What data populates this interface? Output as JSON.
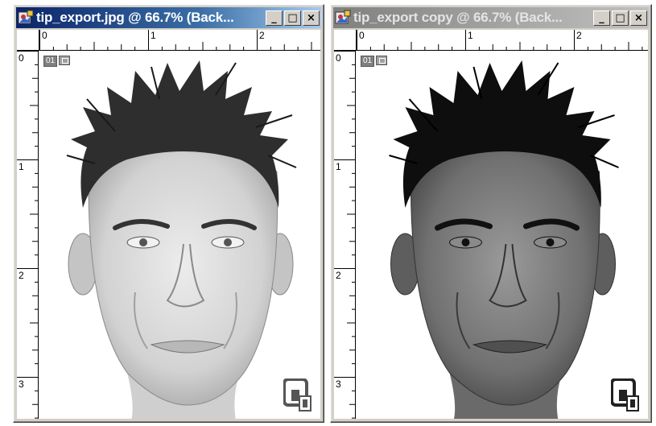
{
  "windows": [
    {
      "id": "left",
      "title": "tip_export.jpg @ 66.7% (Back...",
      "active": true,
      "ruler_h_labels": [
        "0",
        "1",
        "2"
      ],
      "ruler_v_labels": [
        "0",
        "1",
        "2",
        "3"
      ],
      "slice_number": "01",
      "image_tone": "light"
    },
    {
      "id": "right",
      "title": "tip_export copy @ 66.7% (Back...",
      "active": false,
      "ruler_h_labels": [
        "0",
        "1",
        "2"
      ],
      "ruler_v_labels": [
        "0",
        "1",
        "2",
        "3"
      ],
      "slice_number": "01",
      "image_tone": "dark"
    }
  ],
  "controls": {
    "minimize": "_",
    "maximize": "□",
    "close": "×"
  },
  "colors": {
    "active_title": "#0a246a",
    "inactive_title": "#808080",
    "chrome": "#d4d0c8"
  }
}
